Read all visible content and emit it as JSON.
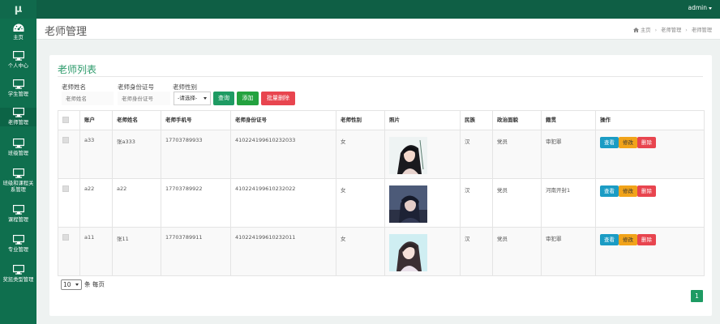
{
  "app": {
    "logo": "μ",
    "user": "admin"
  },
  "sidebar": {
    "items": [
      {
        "label": "主页",
        "icon": "dashboard-icon"
      },
      {
        "label": "个人中心",
        "icon": "monitor-icon"
      },
      {
        "label": "学生管理",
        "icon": "monitor-icon"
      },
      {
        "label": "老师管理",
        "icon": "monitor-icon"
      },
      {
        "label": "班级管理",
        "icon": "monitor-icon"
      },
      {
        "label": "班级和课程关",
        "label2": "系管理",
        "icon": "monitor-icon"
      },
      {
        "label": "课程管理",
        "icon": "monitor-icon"
      },
      {
        "label": "专业管理",
        "icon": "monitor-icon"
      },
      {
        "label": "奖惩类型管理",
        "icon": "monitor-icon"
      }
    ]
  },
  "header": {
    "title": "老师管理",
    "breadcrumb": [
      "主页",
      "老师管理",
      "老师管理"
    ]
  },
  "panel": {
    "title": "老师列表"
  },
  "filters": {
    "name_label": "老师姓名",
    "name_placeholder": "老师姓名",
    "idcard_label": "老师身份证号",
    "idcard_placeholder": "老师身份证号",
    "gender_label": "老师性别",
    "gender_value": "-请选择-",
    "query_button": "查询",
    "add_button": "添加",
    "batch_delete_button": "批量删除"
  },
  "table": {
    "columns": [
      "账户",
      "老师姓名",
      "老师手机号",
      "老师身份证号",
      "老师性别",
      "照片",
      "民族",
      "政治面貌",
      "籍贯",
      "操作"
    ],
    "actions": {
      "view": "查看",
      "edit": "修改",
      "delete": "删除"
    },
    "rows": [
      {
        "account": "a33",
        "name": "张a333",
        "phone": "17703789933",
        "idcard": "410224199610232033",
        "gender": "女",
        "nation": "汉",
        "politics": "党员",
        "origin": "审犯罪"
      },
      {
        "account": "a22",
        "name": "a22",
        "phone": "17703789922",
        "idcard": "410224199610232022",
        "gender": "女",
        "nation": "汉",
        "politics": "党员",
        "origin": "河南开封1"
      },
      {
        "account": "a11",
        "name": "张11",
        "phone": "17703789911",
        "idcard": "410224199610232011",
        "gender": "女",
        "nation": "汉",
        "politics": "党员",
        "origin": "审犯罪"
      }
    ]
  },
  "footer": {
    "page_size": "10",
    "page_size_suffix": "条 每页",
    "current_page": "1"
  },
  "colors": {
    "primary": "#0f6f4e",
    "accent": "#1e9b63",
    "danger": "#e8454f",
    "info": "#1b9cc4",
    "warning": "#f1a31a"
  }
}
